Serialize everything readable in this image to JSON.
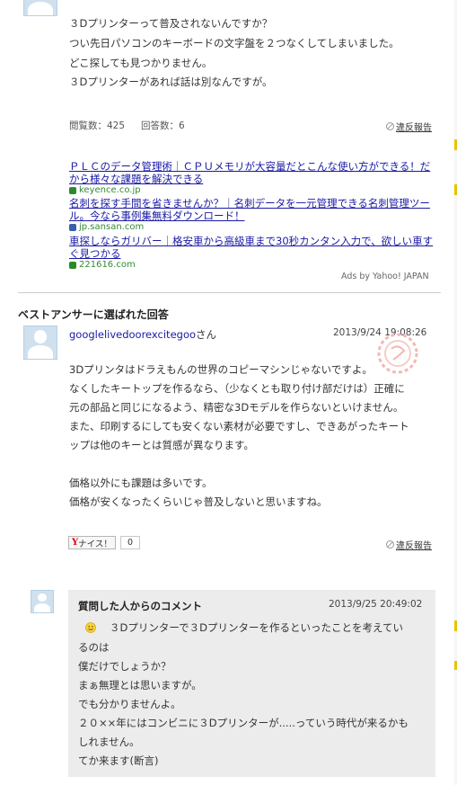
{
  "question": {
    "lines": [
      "３Dプリンターって普及されないんですか？",
      "つい先日パソコンのキーボードの文字盤を２つなくしてしまいました。",
      "どこ探しても見つかりません。",
      "３Dプリンターがあれば話は別なんですが。"
    ],
    "views": "閲覧数：425",
    "answers": "回答数：6",
    "report": "違反報告"
  },
  "ads": {
    "items": [
      {
        "title": "ＰＬＣのデータ管理術｜ＣＰＵメモリが大容量だとこんな使い方ができる！だから様々な課題を解決できる",
        "url": "keyence.co.jp",
        "favicon_color": "#2a8a2a"
      },
      {
        "title": "名刺を探す手間を省きませんか？｜名刺データを一元管理できる名刺管理ツール。今なら事例集無料ダウンロード！",
        "url": "jp.sansan.com",
        "favicon_color": "#3a5fa8"
      },
      {
        "title": "車探しならガリバー｜格安車から高級車まで30秒カンタン入力で、欲しい車すぐ見つかる",
        "url": "221616.com",
        "favicon_color": "#2a8a2a"
      }
    ],
    "footer": "Ads by Yahoo! JAPAN"
  },
  "best_answer": {
    "section_title": "ベストアンサーに選ばれた回答",
    "username": "googlelivedoorexcitegoo",
    "honorific": "さん",
    "date": "2013/9/24",
    "time": "19:08:26",
    "lines": [
      "3Dプリンタはドラえもんの世界のコピーマシンじゃないですよ。",
      "なくしたキートップを作るなら、（少なくとも取り付け部だけは）正確に",
      "元の部品と同じになるよう、精密な3Dモデルを作らないといけません。",
      "また、印刷するにしても安くない素材が必要ですし、できあがったキート",
      "ップは他のキーとは質感が異なります。",
      "",
      "価格以外にも課題は多いです。",
      "価格が安くなったくらいじゃ普及しないと思いますね。"
    ],
    "like_label": "ナイス！",
    "like_count": "0",
    "report": "違反報告"
  },
  "comment": {
    "title": "質問した人からのコメント",
    "datetime": "2013/9/25 20:49:02",
    "lines": [
      "３Dプリンターで３Dプリンターを作るといったことを考えてい",
      "るのは",
      "僕だけでしょうか？",
      "まぁ無理とは思いますが。",
      "でも分かりませんよ。",
      "２０××年にはコンビニに３Dプリンターが.....っていう時代が来るかも",
      "しれません。",
      "てか来ます(断言)"
    ]
  },
  "colors": {
    "link": "#1a1aa6",
    "url_green": "#338a33",
    "comment_bg": "#ececec",
    "yahoo_red": "#e60012"
  }
}
